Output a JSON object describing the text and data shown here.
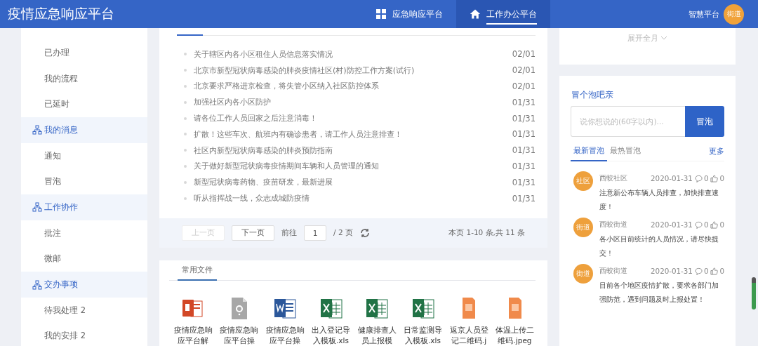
{
  "header": {
    "title": "疫情应急响应平台",
    "nav": [
      {
        "label": "应急响应平台",
        "kind": "grid",
        "selected": false
      },
      {
        "label": "工作办公平台",
        "kind": "home",
        "selected": true
      }
    ],
    "platform_link": "智慧平台",
    "avatar": "街道"
  },
  "sidebar": {
    "groups": [
      {
        "items": [
          "已办理",
          "我的流程",
          "已延时"
        ]
      },
      {
        "title": "我的消息",
        "items": [
          "通知",
          "冒泡"
        ]
      },
      {
        "title": "工作协作",
        "items": [
          "批注",
          "微邮"
        ]
      },
      {
        "title": "交办事项",
        "items": [
          "待我处理 2",
          "我的安排 2"
        ]
      }
    ]
  },
  "news": {
    "items": [
      {
        "title": "关于辖区内各小区租住人员信息落实情况",
        "date": "02/01"
      },
      {
        "title": "北京市新型冠状病毒感染的肺炎疫情社区(村)防控工作方案(试行)",
        "date": "02/01"
      },
      {
        "title": "北京要求严格进京检查，将失管小区纳入社区防控体系",
        "date": "02/01"
      },
      {
        "title": "加强社区内各小区防护",
        "date": "01/31"
      },
      {
        "title": "请各位工作人员回家之后注意消毒！",
        "date": "01/31"
      },
      {
        "title": "扩散！这些车次、航班内有确诊患者，请工作人员注意排查！",
        "date": "01/31"
      },
      {
        "title": "社区内新型冠状病毒感染的肺炎预防指南",
        "date": "01/31"
      },
      {
        "title": "关于做好新型冠状病毒疫情期间车辆和人员管理的通知",
        "date": "01/31"
      },
      {
        "title": "新型冠状病毒药物、疫苗研发，最新进展",
        "date": "01/31"
      },
      {
        "title": "听从指挥战一线，众志成城防疫情",
        "date": "01/31"
      }
    ],
    "pagination": {
      "prev": {
        "label": "上一页",
        "disabled": true
      },
      "next": {
        "label": "下一页",
        "disabled": false
      },
      "goto_label": "前往",
      "page": "1",
      "total": "/ 2 页",
      "summary": "本页 1-10 条,共 11 条"
    }
  },
  "files": {
    "tab": "常用文件",
    "items": [
      {
        "kind": "ppt",
        "name": "疫情应急响应平台解"
      },
      {
        "kind": "unknown",
        "name": "疫情应急响应平台操"
      },
      {
        "kind": "word",
        "name": "疫情应急响应平台操"
      },
      {
        "kind": "excel",
        "name": "出入登记导入模板.xls"
      },
      {
        "kind": "excel",
        "name": "健康排查人员上报模"
      },
      {
        "kind": "excel",
        "name": "日常监测导入模板.xls"
      },
      {
        "kind": "image",
        "name": "返京人员登记二维码.j"
      },
      {
        "kind": "image",
        "name": "体温上传二维码.jpeg"
      }
    ]
  },
  "calendar": {
    "expand_label": "展开全月"
  },
  "bubble": {
    "title": "冒个泡吧亲",
    "placeholder": "说你想说的(60字以内)...",
    "button": "冒泡",
    "tabs": [
      {
        "label": "最新冒泡",
        "selected": true
      },
      {
        "label": "最热冒泡",
        "selected": false
      }
    ],
    "more": "更多",
    "posts": [
      {
        "avatar": "社区",
        "author": "西蛟社区",
        "date": "2020-01-31",
        "comments": "0",
        "likes": "0",
        "text": "注意新公布车辆人员排查，加快排查速度！"
      },
      {
        "avatar": "街道",
        "author": "西蛟街道",
        "date": "2020-01-31",
        "comments": "0",
        "likes": "0",
        "text": "各小区目前统计的人员情况，请尽快提交！"
      },
      {
        "avatar": "街道",
        "author": "西蛟街道",
        "date": "2020-01-31",
        "comments": "0",
        "likes": "0",
        "text": "目前各个地区疫情扩散，要求各部门加强防范，遇到问题及时上报处置！"
      }
    ]
  }
}
